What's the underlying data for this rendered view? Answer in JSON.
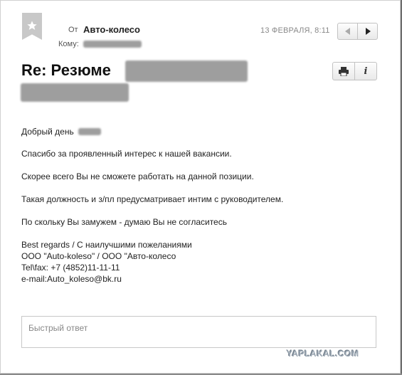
{
  "message": {
    "from_label": "От",
    "from_name": "Авто-колесо",
    "to_label": "Кому:",
    "date": "13 ФЕВРАЛЯ, 8:11",
    "subject": "Re: Резюме"
  },
  "toolbar": {
    "prev_icon": "triangle-left-icon",
    "next_icon": "triangle-right-icon",
    "print_icon": "printer-icon",
    "info_label": "i"
  },
  "body": {
    "greeting": "Добрый день",
    "line1": "Спасибо за проявленный интерес к нашей вакансии.",
    "line2": "Скорее всего Вы не сможете работать на данной позиции.",
    "line3": "Такая должность и з/пл предусматривает интим с руководителем.",
    "line4": "По скольку Вы замужем - думаю Вы не согласитесь",
    "sig1": "Best regards / С наилучшими пожеланиями",
    "sig2": "ООО \"Auto-koleso\" / ООО \"Авто-колесо",
    "sig3": "Tel\\fax: +7 (4852)11-11-11",
    "sig4": "e-mail:Auto_koleso@bk.ru"
  },
  "reply": {
    "placeholder": "Быстрый ответ"
  },
  "watermark": "YAPLAKAL.COM"
}
